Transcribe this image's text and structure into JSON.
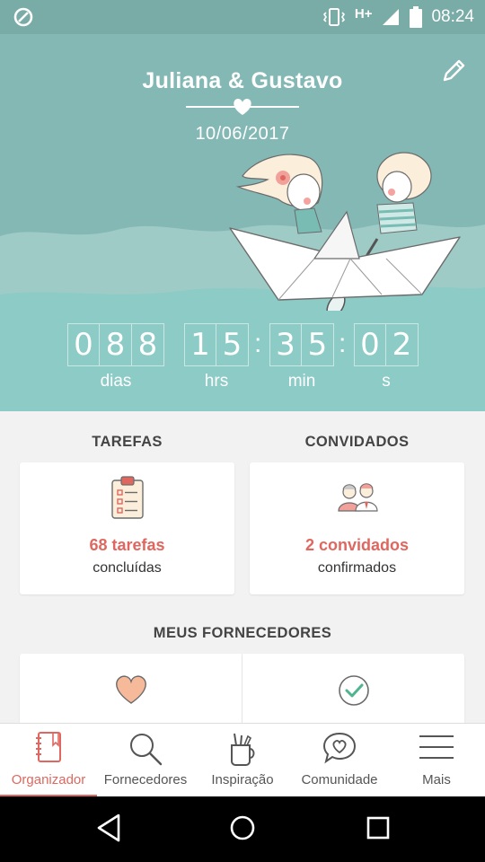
{
  "status_bar": {
    "network": "H+",
    "time": "08:24"
  },
  "header": {
    "couple_names": "Juliana & Gustavo",
    "date": "10/06/2017"
  },
  "countdown": {
    "days": [
      "0",
      "8",
      "8"
    ],
    "hours": [
      "1",
      "5"
    ],
    "minutes": [
      "3",
      "5"
    ],
    "seconds": [
      "0",
      "2"
    ],
    "separator": ":",
    "labels": {
      "days": "dias",
      "hours": "hrs",
      "minutes": "min",
      "seconds": "s"
    }
  },
  "tasks": {
    "title": "TAREFAS",
    "count_label": "68 tarefas",
    "status": "concluídas"
  },
  "guests": {
    "title": "CONVIDADOS",
    "count_label": "2 convidados",
    "status": "confirmados"
  },
  "suppliers": {
    "title": "MEUS FORNECEDORES"
  },
  "bottom_nav": [
    {
      "label": "Organizador",
      "icon": "notebook-icon",
      "active": true
    },
    {
      "label": "Fornecedores",
      "icon": "search-icon",
      "active": false
    },
    {
      "label": "Inspiração",
      "icon": "inspiration-cup-icon",
      "active": false
    },
    {
      "label": "Comunidade",
      "icon": "chat-heart-icon",
      "active": false
    },
    {
      "label": "Mais",
      "icon": "menu-icon",
      "active": false
    }
  ],
  "colors": {
    "accent": "#e0675f",
    "teal": "#84b8b4",
    "status_bar": "#79aba7"
  }
}
